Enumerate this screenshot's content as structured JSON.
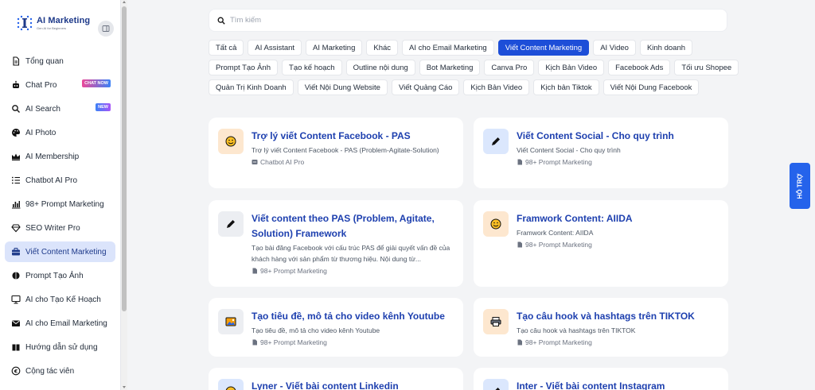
{
  "brand": {
    "title": "AI Marketing",
    "subtitle": "Gen AI for Beginners"
  },
  "sidebar": {
    "items": [
      {
        "label": "Tổng quan",
        "icon": "document-icon"
      },
      {
        "label": "Chat Pro",
        "icon": "robot-icon",
        "badge": "CHAT NOW"
      },
      {
        "label": "AI Search",
        "icon": "search-icon",
        "badge": "NEW"
      },
      {
        "label": "AI Photo",
        "icon": "palette-icon"
      },
      {
        "label": "AI Membership",
        "icon": "crown-icon"
      },
      {
        "label": "Chatbot AI Pro",
        "icon": "list-icon"
      },
      {
        "label": "98+ Prompt Marketing",
        "icon": "bar-chart-icon"
      },
      {
        "label": "SEO Writer Pro",
        "icon": "diamond-icon"
      },
      {
        "label": "Viết Content Marketing",
        "icon": "briefcase-icon",
        "active": true
      },
      {
        "label": "Prompt Tạo Ảnh",
        "icon": "brain-icon"
      },
      {
        "label": "AI cho Tạo Kế Hoạch",
        "icon": "monitor-icon"
      },
      {
        "label": "AI cho Email Marketing",
        "icon": "mail-icon"
      },
      {
        "label": "Hướng dẫn sử dụng",
        "icon": "book-icon"
      },
      {
        "label": "Cộng tác viên",
        "icon": "coin-icon"
      }
    ]
  },
  "search": {
    "placeholder": "Tìm kiếm"
  },
  "tags": [
    [
      "Tất cả",
      "AI Assistant",
      "AI Marketing",
      "Khác",
      "AI cho Email Marketing",
      "Viết Content Marketing",
      "AI Video",
      "Kinh doanh"
    ],
    [
      "Prompt Tạo Ảnh",
      "Tạo kế hoạch",
      "Outline nội dung",
      "Bot Marketing",
      "Canva Pro",
      "Kịch Bản Video",
      "Facebook Ads",
      "Tối ưu Shopee"
    ],
    [
      "Quản Trị Kinh Doanh",
      "Viết Nội Dung Website",
      "Viết Quảng Cáo",
      "Kịch Bản Video",
      "Kịch bản Tiktok",
      "Viết Nội Dung Facebook"
    ]
  ],
  "active_tag": "Viết Content Marketing",
  "cards": [
    {
      "title": "Trợ lý viết Content Facebook - PAS",
      "desc": "Trợ lý viết Content Facebook - PAS (Problem-Agitate-Solution)",
      "source": "Chatbot AI Pro",
      "icon": "smiley-icon"
    },
    {
      "title": "Viết Content Social - Cho quy trình",
      "desc": "Viết Content Social - Cho quy trình",
      "source": "98+ Prompt Marketing",
      "icon": "pen-icon"
    },
    {
      "title": "Viết content theo PAS (Problem, Agitate, Solution) Framework",
      "desc": "Tạo bài đăng Facebook với cấu trúc PAS để giải quyết vấn đề của khách hàng với sản phẩm từ thương hiệu. Nội dung từ...",
      "source": "98+ Prompt Marketing",
      "icon": "pen-icon"
    },
    {
      "title": "Framwork Content: AIIDA",
      "desc": "Framwork Content: AIIDA",
      "source": "98+ Prompt Marketing",
      "icon": "smiley-icon"
    },
    {
      "title": "Tạo tiêu đề, mô tả cho video kênh Youtube",
      "desc": "Tạo tiêu đề, mô tả cho video kênh Youtube",
      "source": "98+ Prompt Marketing",
      "icon": "picture-icon"
    },
    {
      "title": "Tạo câu hook và hashtags trên TIKTOK",
      "desc": "Tạo câu hook và hashtags trên TIKTOK",
      "source": "98+ Prompt Marketing",
      "icon": "printer-icon"
    },
    {
      "title": "Lyner - Viết bài content Linkedin",
      "desc": "",
      "source": "",
      "icon": "smiley-icon"
    },
    {
      "title": "Inter - Viết bài content Instagram",
      "desc": "",
      "source": "",
      "icon": "pen-icon"
    }
  ],
  "support": {
    "label": "HỖ TRỢ"
  }
}
